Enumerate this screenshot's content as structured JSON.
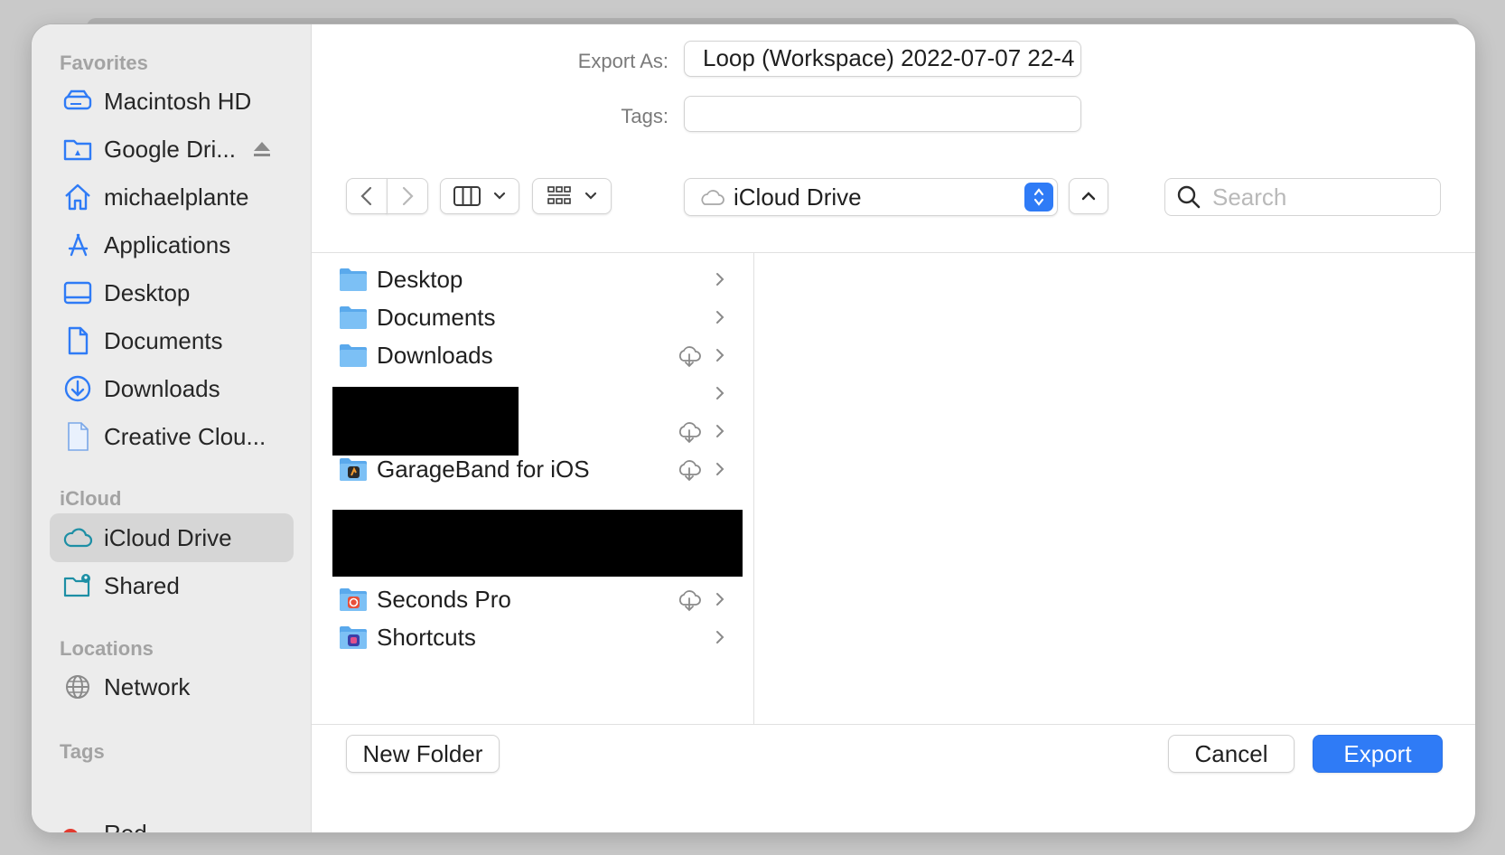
{
  "dialog": {
    "export_as_label": "Export As:",
    "export_as_value": "Loop (Workspace) 2022-07-07 22-4",
    "tags_label": "Tags:",
    "tags_value": ""
  },
  "sidebar": {
    "favorites_label": "Favorites",
    "favorites": [
      {
        "label": "Macintosh HD",
        "icon": "hard-drive-icon"
      },
      {
        "label": "Google Dri...",
        "icon": "google-drive-folder-icon",
        "ejectable": true
      },
      {
        "label": "michaelplante",
        "icon": "home-icon"
      },
      {
        "label": "Applications",
        "icon": "applications-icon"
      },
      {
        "label": "Desktop",
        "icon": "desktop-icon"
      },
      {
        "label": "Documents",
        "icon": "document-icon"
      },
      {
        "label": "Downloads",
        "icon": "downloads-icon"
      },
      {
        "label": "Creative Clou...",
        "icon": "file-icon"
      }
    ],
    "icloud_label": "iCloud",
    "icloud": [
      {
        "label": "iCloud Drive",
        "icon": "cloud-icon",
        "selected": true
      },
      {
        "label": "Shared",
        "icon": "shared-folder-icon"
      }
    ],
    "locations_label": "Locations",
    "locations": [
      {
        "label": "Network",
        "icon": "globe-icon"
      }
    ],
    "tags_label": "Tags",
    "tags": [
      {
        "label": "Red",
        "color": "#e23a2f"
      }
    ]
  },
  "toolbar": {
    "location": "iCloud Drive",
    "search_placeholder": "Search"
  },
  "files": [
    {
      "name": "Desktop",
      "icon": "folder-icon",
      "cloud": false
    },
    {
      "name": "Documents",
      "icon": "folder-icon",
      "cloud": false
    },
    {
      "name": "Downloads",
      "icon": "folder-icon",
      "cloud": true
    },
    {
      "name": "",
      "icon": "",
      "cloud": false,
      "redacted": true
    },
    {
      "name": "",
      "icon": "",
      "cloud": true,
      "redacted": true
    },
    {
      "name": "GarageBand for iOS",
      "icon": "garageband-folder-icon",
      "cloud": true
    },
    {
      "name": "",
      "icon": "",
      "cloud": false,
      "redacted": true
    },
    {
      "name": "Seconds Pro",
      "icon": "seconds-pro-folder-icon",
      "cloud": true
    },
    {
      "name": "Shortcuts",
      "icon": "shortcuts-folder-icon",
      "cloud": false
    }
  ],
  "footer": {
    "new_folder_label": "New Folder",
    "cancel_label": "Cancel",
    "export_label": "Export"
  },
  "colors": {
    "accent": "#2f7bf6",
    "sidebar_icon": "#2f7bf6",
    "tag_red": "#e23a2f"
  }
}
